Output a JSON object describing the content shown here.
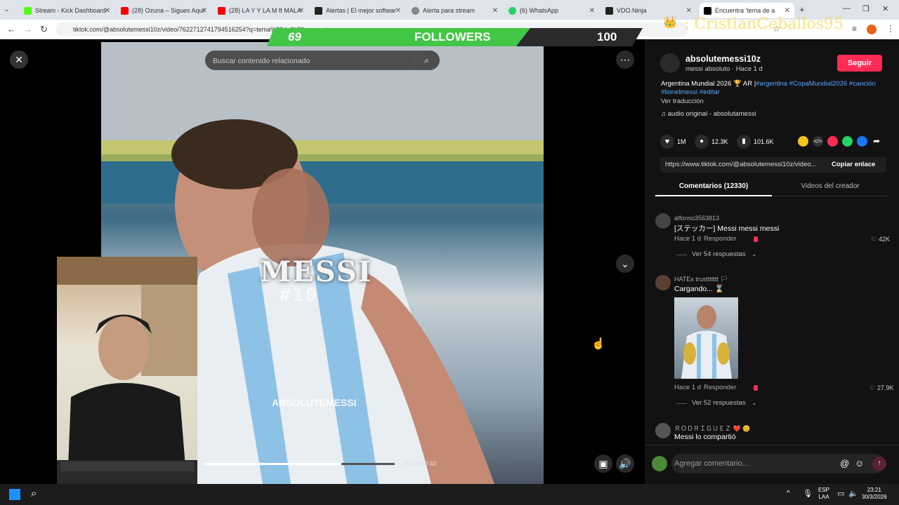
{
  "tabs": [
    {
      "label": "Stream - Kick Dashboard",
      "color": "#53fc18"
    },
    {
      "label": "(28) Ozuna – Sigues Aquí",
      "color": "#ff0000"
    },
    {
      "label": "(28) LA Y Y LA M ft MALA",
      "color": "#ff0000"
    },
    {
      "label": "Alertas | El mejor softwar",
      "color": "#222222"
    },
    {
      "label": "Alerta para stream",
      "color": "#888888"
    },
    {
      "label": "(6) WhatsApp",
      "color": "#25d366"
    },
    {
      "label": "VDO.Ninja",
      "color": "#222222"
    },
    {
      "label": "Encuentra 'tema de a",
      "color": "#000000"
    }
  ],
  "address": {
    "url": "tiktok.com/@absolutemessi10z/video/7622712741794516254?q=tema%20del%20momento"
  },
  "overlay": {
    "followers_current": "69",
    "followers_label": "FOLLOWERS",
    "followers_goal": "100",
    "crown_name": ": CristianCeballos95"
  },
  "search": {
    "placeholder": "Buscar contenido relacionado"
  },
  "video": {
    "title": "MESSI",
    "number": "#10",
    "watermark": "ABSOLUTEMESSI",
    "time": "00:29/00:40",
    "progress_fraction": 0.72
  },
  "author": {
    "handle": "absolutemessi10z",
    "subtitle": "messi absoluto · Hace 1 d",
    "follow_label": "Seguir"
  },
  "description": {
    "text": "Argentina Mundial 2026 🏆 AR |",
    "hashtags": "#argentina #CopaMundial2026 #canción #lionelmessi #editar",
    "translate": "Ver traducción",
    "audio": "audio original - absolutamessi"
  },
  "stats": {
    "likes": "1M",
    "comments": "12.3K",
    "saves": "101.6K"
  },
  "share": {
    "link": "https://www.tiktok.com/@absolutemessi10z/video...",
    "copy_label": "Copiar enlace"
  },
  "panel_tabs": {
    "comments": "Comentarios (12330)",
    "creator": "Videos del creador"
  },
  "comments": [
    {
      "user": "alfonso3563813",
      "text": "[ステッカー] Messi messi messi",
      "time": "Hace 1 d",
      "reply": "Responder",
      "likes": "42K",
      "replies": "Ver 54 respuestas"
    },
    {
      "user": "HATEx trusttttttt 🏳",
      "text": "Cargando... ⌛",
      "time": "Hace 1 d",
      "reply": "Responder",
      "likes": "27.9K",
      "replies": "Ver 52 respuestas"
    },
    {
      "user": "ＲＯＤＲＩＧＵＥＺ ❤️ 😊",
      "text": "Messi lo compartió"
    }
  ],
  "comment_input": {
    "placeholder": "Agregar comentario..."
  },
  "taskbar": {
    "lang_top": "ESP",
    "lang_bottom": "LAA",
    "time": "23:21",
    "date": "30/3/2026"
  }
}
